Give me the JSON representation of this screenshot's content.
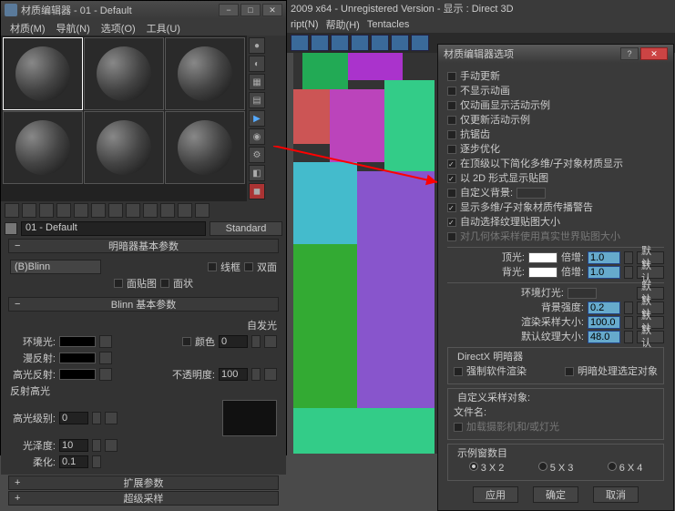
{
  "left_title": "材质编辑器 - 01 - Default",
  "menus": {
    "mat": "材质(M)",
    "nav": "导航(N)",
    "opt": "选项(O)",
    "tool": "工具(U)"
  },
  "mat_name": "01 - Default",
  "mat_type": "Standard",
  "sections": {
    "shader": "明暗器基本参数",
    "blinn": "Blinn 基本参数",
    "extend": "扩展参数",
    "super": "超级采样"
  },
  "shader_dd": "(B)Blinn",
  "shader_opts": {
    "wire": "线框",
    "two": "双面",
    "facemap": "面贴图",
    "faceted": "面状"
  },
  "blinn": {
    "selfillum": "自发光",
    "color": "颜色",
    "color_val": "0",
    "ambient": "环境光:",
    "diffuse": "漫反射:",
    "spec": "高光反射:",
    "opacity": "不透明度:",
    "opacity_val": "100",
    "reflhl": "反射高光",
    "speclvl": "高光级别:",
    "speclvl_v": "0",
    "gloss": "光泽度:",
    "gloss_v": "10",
    "soften": "柔化:",
    "soften_v": "0.1"
  },
  "app_title": "2009 x64  - Unregistered Version   -  显示 : Direct 3D",
  "app_menus": {
    "script": "ript(N)",
    "help": "帮助(H)",
    "tent": "Tentacles"
  },
  "dlg": {
    "title": "材质编辑器选项",
    "manual": "手动更新",
    "noanim": "不显示动画",
    "onlyanim": "仅动画显示活动示例",
    "onlyact": "仅更新活动示例",
    "antia": "抗锯齿",
    "prog": "逐步优化",
    "simp": "在顶级以下简化多维/子对象材质显示",
    "show2d": "以 2D 形式显示贴图",
    "custbg": "自定义背景:",
    "multiwarn": "显示多维/子对象材质传播警告",
    "autotex": "自动选择纹理贴图大小",
    "realworld": "对几何体采样使用真实世界贴图大小",
    "top": "顶光:",
    "back": "背光:",
    "mult": "倍增:",
    "mult_v": "1.0",
    "default": "默认",
    "amblight": "环境灯光:",
    "bgint": "背景强度:",
    "bgint_v": "0.2",
    "rendsz": "渲染采样大小:",
    "rendsz_v": "100.0",
    "texsz": "默认纹理大小:",
    "texsz_v": "48.0",
    "dx": "DirectX 明暗器",
    "force": "强制软件渲染",
    "shadesel": "明暗处理选定对象",
    "custsamp": "自定义采样对象:",
    "filename": "文件名:",
    "loadcam": "加载摄影机和/或灯光",
    "slots": "示例窗数目",
    "r32": "3 X 2",
    "r53": "5 X 3",
    "r64": "6 X 4",
    "apply": "应用",
    "ok": "确定",
    "cancel": "取消"
  }
}
